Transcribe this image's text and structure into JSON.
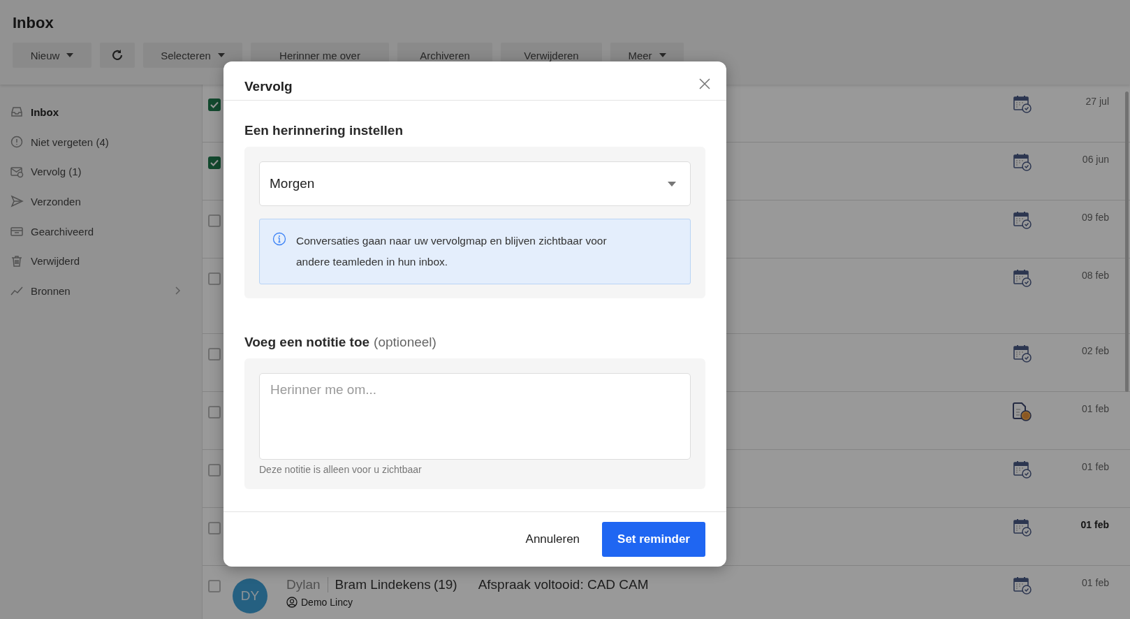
{
  "page": {
    "title": "Inbox"
  },
  "toolbar": [
    {
      "label": "Nieuw",
      "kind": "dropdown"
    },
    {
      "kind": "refresh"
    },
    {
      "label": "Selecteren",
      "kind": "dropdown"
    },
    {
      "label": "Herinner me over",
      "kind": "button"
    },
    {
      "label": "Archiveren",
      "kind": "button"
    },
    {
      "label": "Verwijderen",
      "kind": "button"
    },
    {
      "label": "Meer",
      "kind": "dropdown"
    }
  ],
  "sidebar": {
    "items": [
      {
        "label": "Inbox",
        "kind": "inbox",
        "selected": true,
        "expandable": false
      },
      {
        "label": "Niet vergeten (4)",
        "kind": "alert",
        "selected": false,
        "expandable": false
      },
      {
        "label": "Vervolg (1)",
        "kind": "followup",
        "selected": false,
        "expandable": false
      },
      {
        "label": "Verzonden",
        "kind": "sent",
        "selected": false,
        "expandable": false
      },
      {
        "label": "Gearchiveerd",
        "kind": "archive",
        "selected": false,
        "expandable": false
      },
      {
        "label": "Verwijderd",
        "kind": "trash",
        "selected": false,
        "expandable": false
      },
      {
        "label": "Bronnen",
        "kind": "chart",
        "selected": false,
        "expandable": true
      }
    ]
  },
  "messages": [
    {
      "checked": true,
      "kind": "calendar",
      "date": "27 jul",
      "unread": false,
      "tall": false
    },
    {
      "checked": true,
      "kind": "calendar",
      "date": "06 jun",
      "unread": false,
      "tall": false
    },
    {
      "checked": false,
      "kind": "calendar",
      "date": "09 feb",
      "unread": false,
      "tall": false
    },
    {
      "checked": false,
      "kind": "calendar",
      "date": "08 feb",
      "unread": false,
      "tall": true
    },
    {
      "checked": false,
      "kind": "calendar",
      "date": "02 feb",
      "unread": false,
      "tall": false
    },
    {
      "checked": false,
      "kind": "invoice",
      "date": "01 feb",
      "unread": false,
      "tall": false
    },
    {
      "checked": false,
      "kind": "calendar",
      "date": "01 feb",
      "unread": false,
      "tall": false
    },
    {
      "checked": false,
      "kind": "calendar",
      "date": "01 feb",
      "unread": true,
      "tall": false
    },
    {
      "checked": false,
      "kind": "calendar",
      "date": "01 feb",
      "unread": false,
      "tall": false,
      "avatar": "DY",
      "agent": "Dylan",
      "contact": "Bram Lindekens",
      "count": "(19)",
      "subject": "Afspraak voltooid: CAD CAM",
      "team": "Demo Lincy"
    }
  ],
  "modal": {
    "title": "Vervolg",
    "reminder_heading": "Een herinnering instellen",
    "reminder_select": {
      "value": "Morgen"
    },
    "info": "Conversaties gaan naar uw vervolgmap en blijven zichtbaar voor andere teamleden in hun inbox.",
    "note_heading": "Voeg een notitie toe",
    "note_optional": "(optioneel)",
    "note_field": {
      "placeholder": "Herinner me om..."
    },
    "note_hint": "Deze notitie is alleen voor u zichtbaar",
    "buttons": [
      {
        "label": "Annuleren",
        "kind": "secondary"
      },
      {
        "label": "Set reminder",
        "kind": "primary"
      }
    ]
  }
}
